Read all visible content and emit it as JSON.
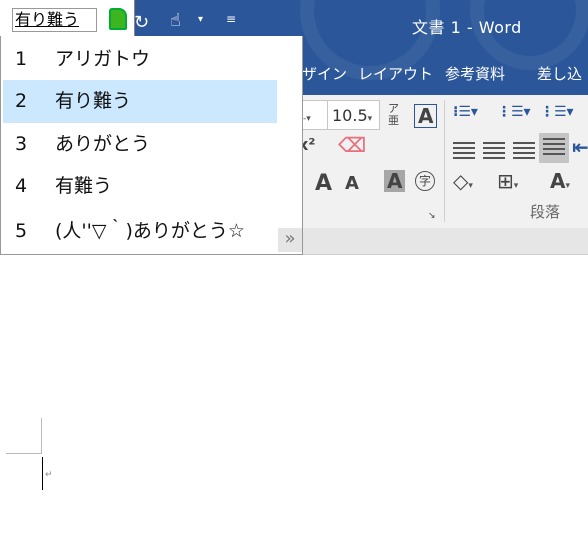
{
  "window": {
    "title": "文書 1  -  Word",
    "accent": "#2b579a"
  },
  "quick_access": {
    "undo_icon": "redo-icon",
    "touch_icon": "touch-mode-icon",
    "customize_icon": "customize-icon"
  },
  "tabs": [
    "ザイン",
    "レイアウト",
    "参考資料",
    "差し込"
  ],
  "ribbon": {
    "font_size": "10.5",
    "group_label": "段落",
    "superscript": "x²",
    "furigana": "ア亜",
    "char_border": "A",
    "grow_font": "A",
    "shrink_font": "A",
    "char_shading": "A",
    "enclose_char": "字"
  },
  "ime": {
    "composition": "有り難う",
    "candidates": [
      {
        "num": "1",
        "text": "アリガトウ"
      },
      {
        "num": "2",
        "text": "有り難う",
        "selected": true
      },
      {
        "num": "3",
        "text": "ありがとう"
      },
      {
        "num": "4",
        "text": "有難う"
      },
      {
        "num": "5",
        "text": "(人''▽｀)ありがとう☆"
      }
    ],
    "more_label": "»",
    "selection_color": "#cce8ff"
  },
  "document": {
    "paragraph_mark": "↵"
  }
}
